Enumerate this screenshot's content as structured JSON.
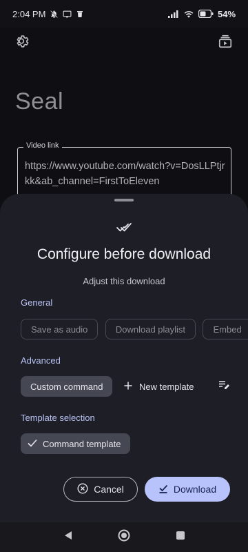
{
  "status_bar": {
    "time": "2:04 PM",
    "battery": "54"
  },
  "app": {
    "title": "Seal",
    "settings_icon": "gear-icon",
    "queue_icon": "download-queue-icon"
  },
  "video_link": {
    "label": "Video link",
    "value": "https://www.youtube.com/watch?v=DosLLPtjrkk&ab_channel=FirstToEleven"
  },
  "sheet": {
    "header_icon": "double-check-icon",
    "title": "Configure before download",
    "subtitle": "Adjust this download",
    "general": {
      "label": "General",
      "chips": [
        "Save as audio",
        "Download playlist",
        "Embed"
      ]
    },
    "advanced": {
      "label": "Advanced",
      "custom_command": "Custom command",
      "new_template": "New template",
      "edit_icon": "playlist-edit-icon"
    },
    "template_selection": {
      "label": "Template selection",
      "selected": "Command template"
    },
    "cancel_label": "Cancel",
    "download_label": "Download"
  },
  "colors": {
    "sheet_bg": "#1e1f26",
    "accent": "#b9c3fb",
    "section_label": "#b9c2f5"
  }
}
